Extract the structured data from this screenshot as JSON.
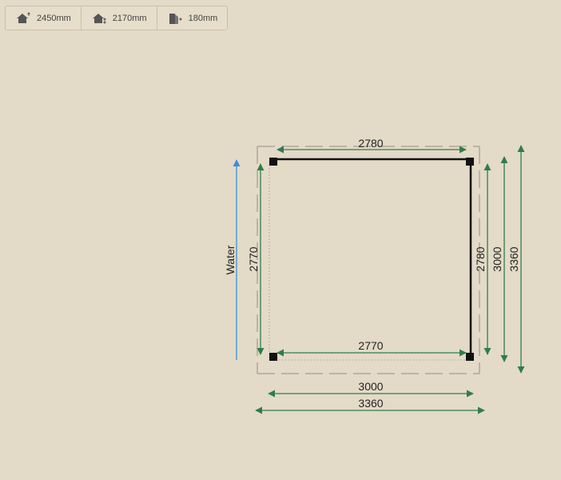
{
  "toolbar": {
    "items": [
      {
        "icon": "house-ridge-height-icon",
        "label": "2450mm"
      },
      {
        "icon": "house-eave-height-icon",
        "label": "2170mm"
      },
      {
        "icon": "door-height-icon",
        "label": "180mm"
      }
    ]
  },
  "plan": {
    "water_label": "Water",
    "dims": {
      "top_inner": "2780",
      "bottom_inner": "2770",
      "left_inner": "2770",
      "right_inner": "2780",
      "right_mid": "3000",
      "right_outer": "3360",
      "bottom_mid": "3000",
      "bottom_outer": "3360"
    },
    "colors": {
      "background": "#e3dac7",
      "dimension_arrow": "#2e7d4a",
      "water_arrow": "#3a8fd8",
      "structure": "#111111",
      "dashed_outline": "#b0a898"
    }
  }
}
